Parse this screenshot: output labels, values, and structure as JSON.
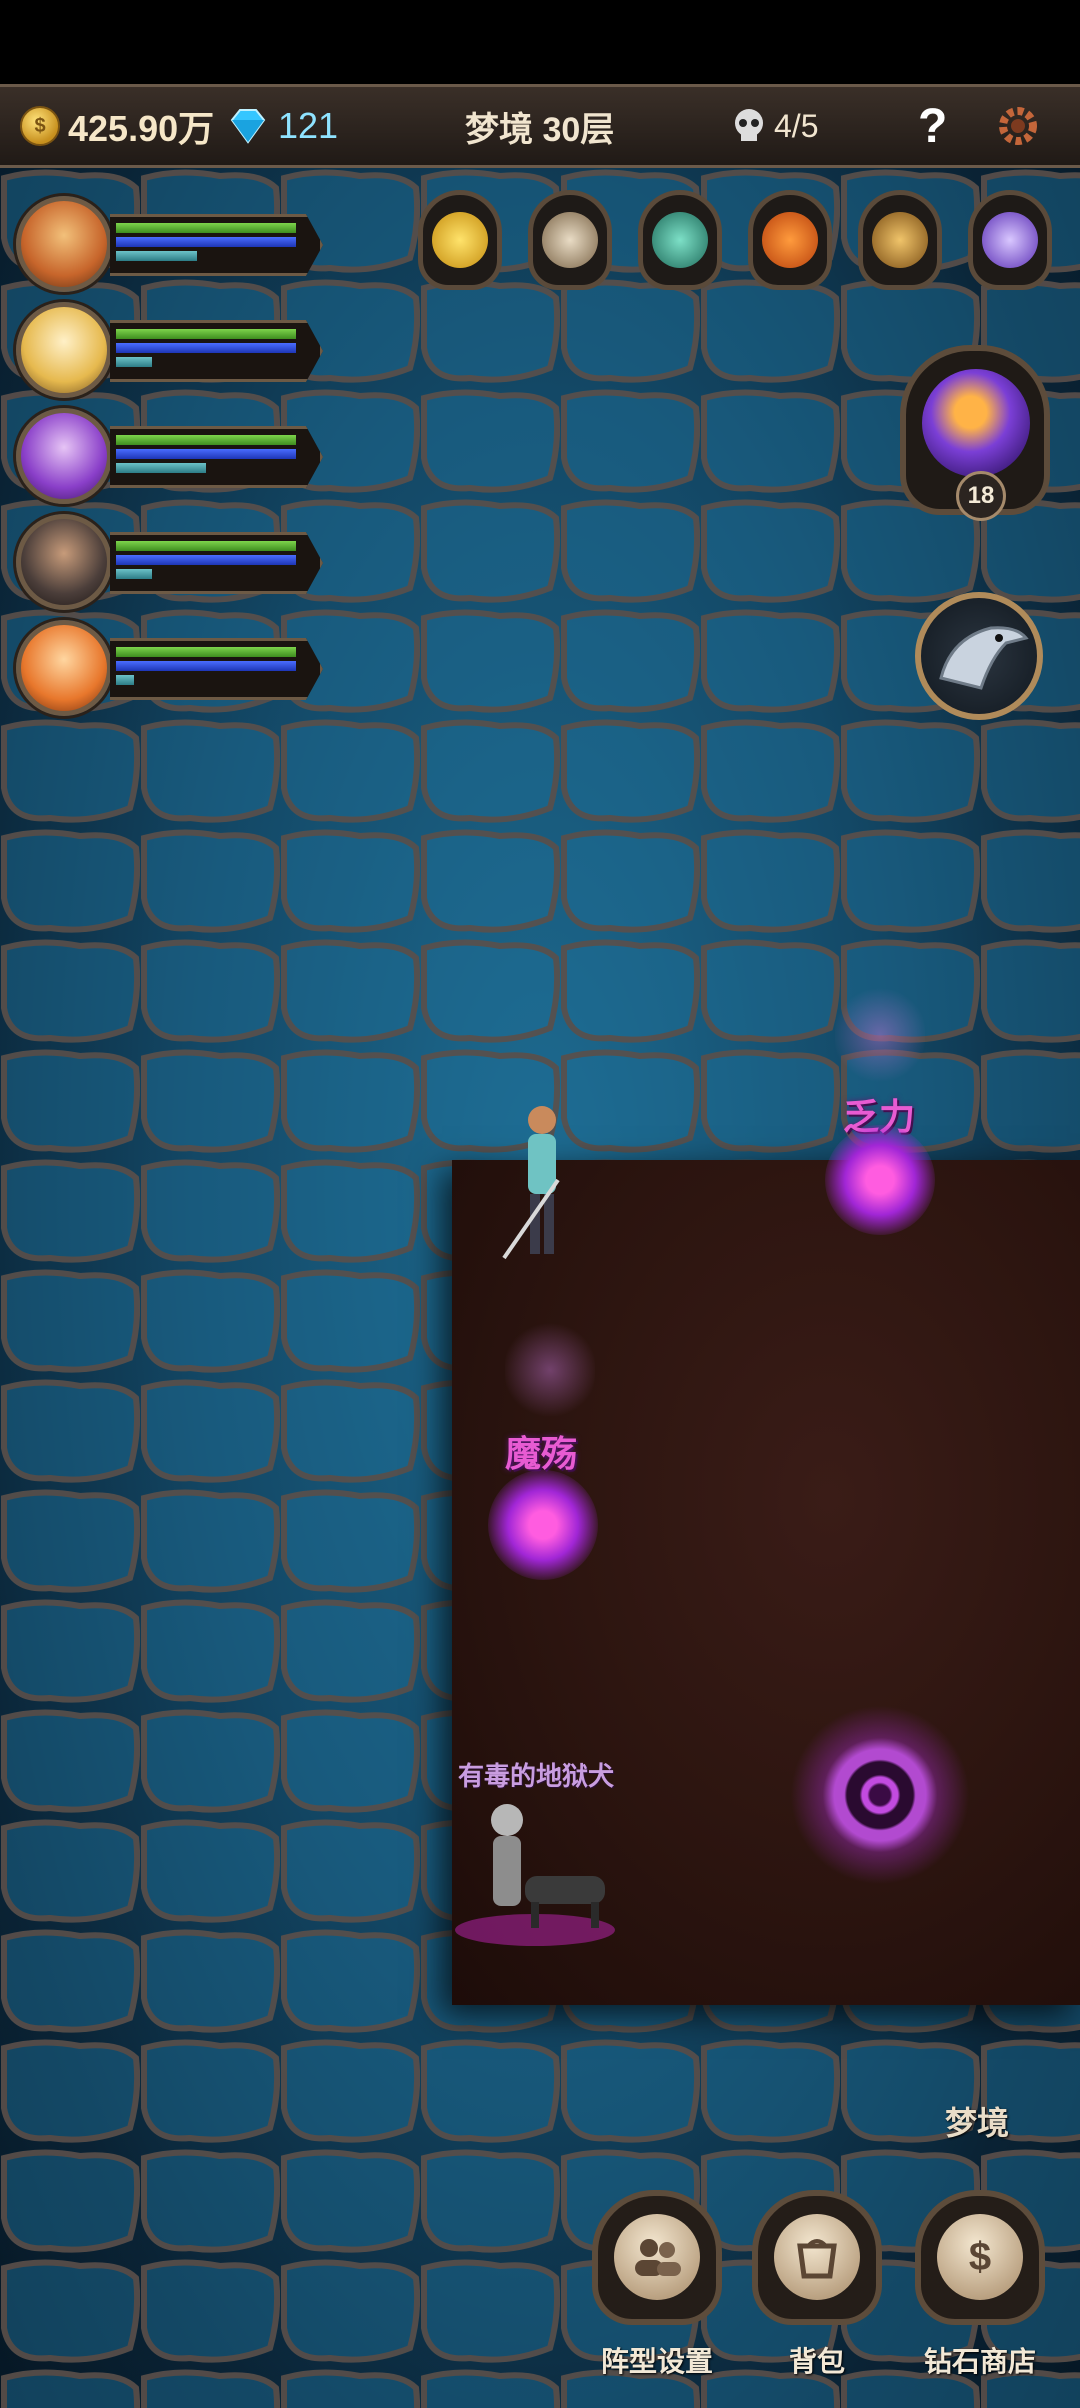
{
  "topbar": {
    "gold": "425.90万",
    "diamonds": "121",
    "floor": "梦境 30层",
    "kills": "4/5",
    "help": "?"
  },
  "heroes": [
    {
      "name": "hero-1",
      "hp": 1.0,
      "mp": 1.0,
      "xp": 0.45
    },
    {
      "name": "hero-2",
      "hp": 1.0,
      "mp": 1.0,
      "xp": 0.2
    },
    {
      "name": "hero-3",
      "hp": 1.0,
      "mp": 1.0,
      "xp": 0.5
    },
    {
      "name": "hero-4",
      "hp": 1.0,
      "mp": 1.0,
      "xp": 0.2
    },
    {
      "name": "hero-5",
      "hp": 1.0,
      "mp": 1.0,
      "xp": 0.1
    }
  ],
  "buffs": [
    "feather-icon",
    "griffin-icon",
    "potion-icon",
    "pumpkin-icon",
    "bell-icon",
    "dragon-icon"
  ],
  "skill": {
    "level": "18"
  },
  "enemies": {
    "ghost1": "乏力",
    "ghost2": "魔殇",
    "hound": "有毒的地狱犬"
  },
  "zone": "梦境",
  "menu": {
    "formation": "阵型设置",
    "bag": "背包",
    "shop": "钻石商店"
  },
  "colors": {
    "hp": "#5fbf33",
    "mp": "#2f50e0",
    "xp": "#4fa7b0",
    "enemy_label": "#e85bd2"
  }
}
